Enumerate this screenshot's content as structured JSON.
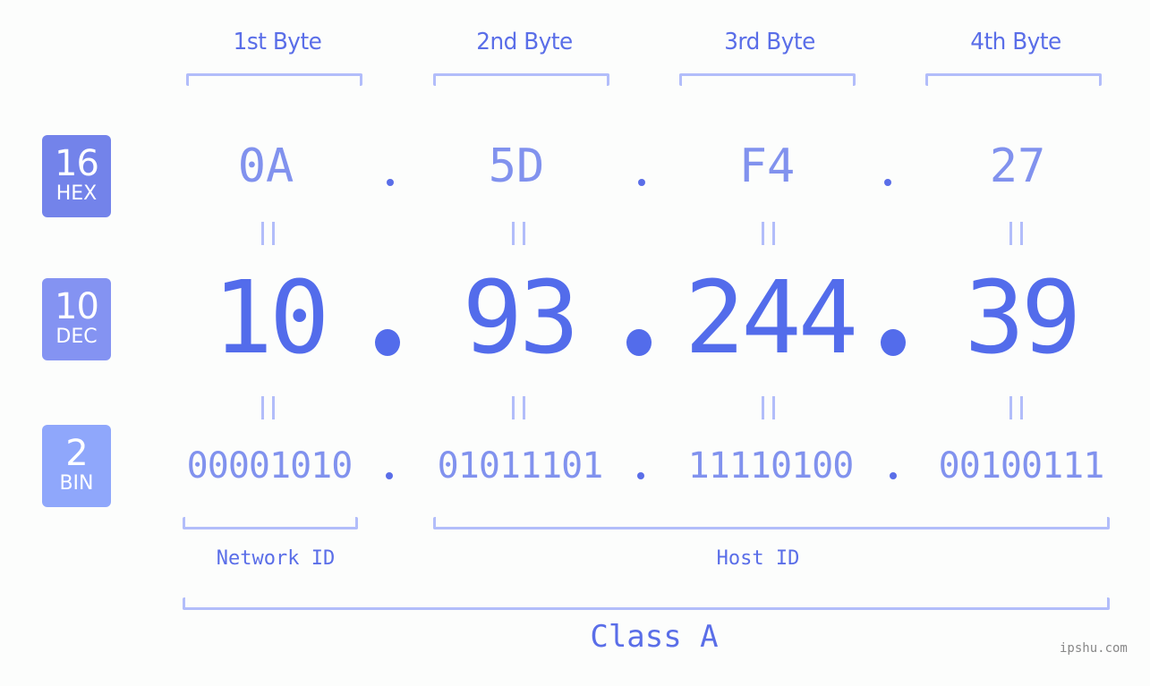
{
  "colors": {
    "primary": "#536ceb",
    "label": "#5a6ee8",
    "secondary": "#8192ee",
    "bracket": "#b2bdfa",
    "badge_hex": "#7383ea",
    "badge_dec": "#8493f2",
    "badge_bin": "#8fa7fb",
    "background": "#fcfdfc"
  },
  "byte_headers": [
    "1st Byte",
    "2nd Byte",
    "3rd Byte",
    "4th Byte"
  ],
  "badges": {
    "hex": {
      "number": "16",
      "label": "HEX"
    },
    "dec": {
      "number": "10",
      "label": "DEC"
    },
    "bin": {
      "number": "2",
      "label": "BIN"
    }
  },
  "hex_values": [
    "0A",
    "5D",
    "F4",
    "27"
  ],
  "dec_values": [
    "10",
    "93",
    "244",
    "39"
  ],
  "bin_values": [
    "00001010",
    "01011101",
    "11110100",
    "00100111"
  ],
  "separator": ".",
  "segments": {
    "network_id": "Network ID",
    "host_id": "Host ID"
  },
  "ip_class": "Class A",
  "watermark": "ipshu.com"
}
